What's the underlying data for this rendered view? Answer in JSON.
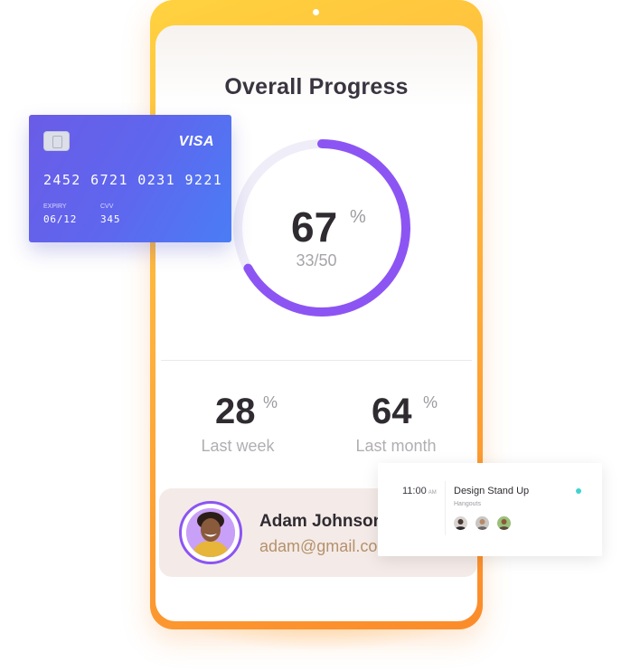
{
  "progress": {
    "title": "Overall Progress",
    "value": "67",
    "percent_sign": "%",
    "ratio": "33/50",
    "fraction": 0.67
  },
  "stats": [
    {
      "value": "28",
      "percent_sign": "%",
      "label": "Last week"
    },
    {
      "value": "64",
      "percent_sign": "%",
      "label": "Last month"
    }
  ],
  "profile": {
    "name": "Adam Johnson",
    "email": "adam@gmail.com"
  },
  "card": {
    "brand": "VISA",
    "number": "2452 6721 0231 9221",
    "expiry_label": "EXPIRY",
    "expiry_value": "06/12",
    "cvv_label": "CVV",
    "cvv_value": "345"
  },
  "event": {
    "time": "11:00",
    "ampm": "AM",
    "title": "Design Stand Up",
    "subtitle": "Hangouts"
  },
  "colors": {
    "phone_frame": "#ffb13b",
    "ring_progress": "#8c55f3",
    "ring_track": "#efedf8",
    "card_gradient_start": "#6a5ce7",
    "card_gradient_end": "#4a7df5",
    "status_dot": "#3fd4d0",
    "email_color": "#b5916b"
  }
}
